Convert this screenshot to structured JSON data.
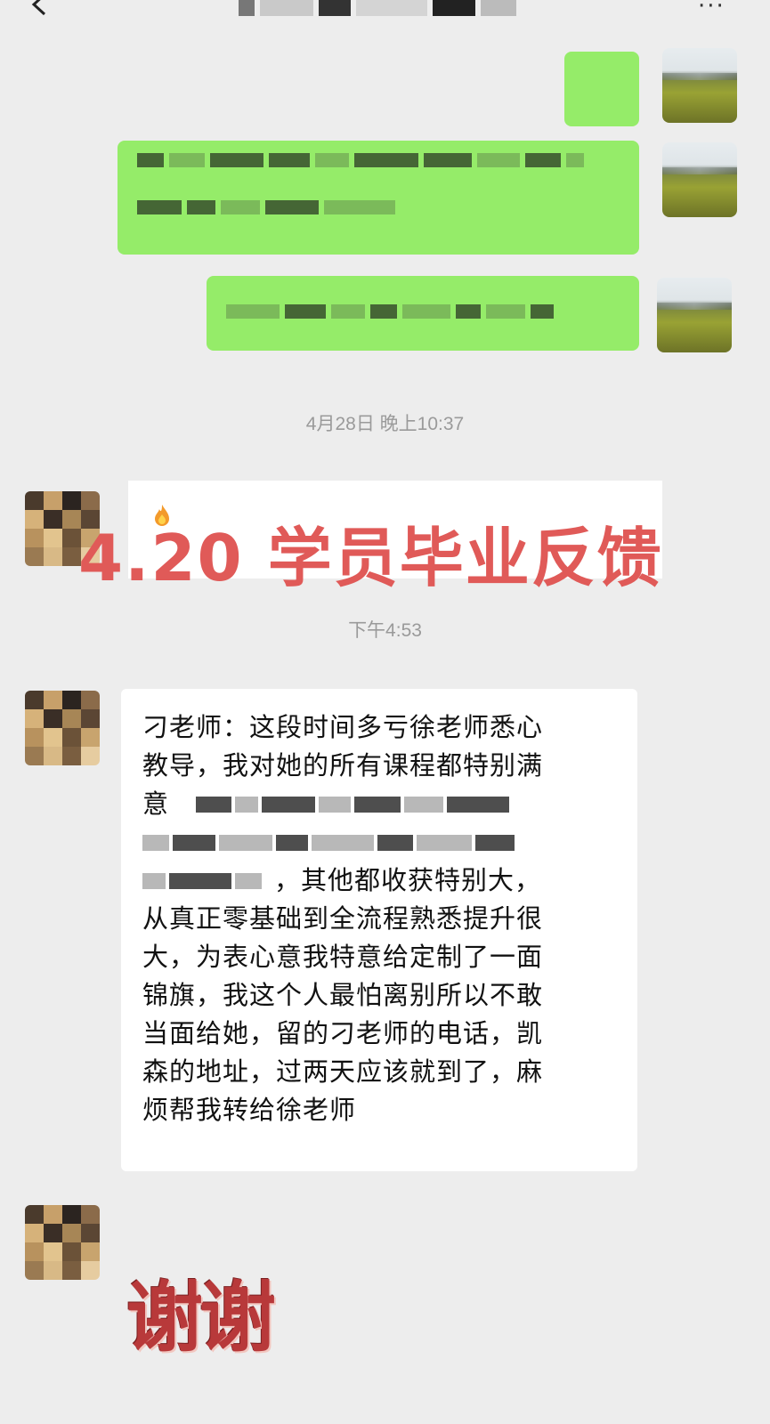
{
  "header": {
    "back_icon": "chevron-left-icon",
    "more_icon": "more-dots-icon",
    "more_label": "···"
  },
  "chat": {
    "timestamps": [
      "4月28日 晚上10:37",
      "下午4:53"
    ],
    "headline": "4.20 学员毕业反馈",
    "message": {
      "lines": [
        "刁老师：这段时间多亏徐老师悉心",
        "教导，我对她的所有课程都特别满",
        "意"
      ],
      "after_blur": "，其他都收获特别大，",
      "lines_after": [
        "从真正零基础到全流程熟悉提升很",
        "大，为表心意我特意给定制了一面",
        "锦旗，我这个人最怕离别所以不敢",
        "当面给她，留的刁老师的电话，凯",
        "森的地址，过两天应该就到了，麻",
        "烦帮我转给徐老师"
      ]
    },
    "sticker_text": "谢谢"
  },
  "colors": {
    "background": "#ededed",
    "sent_bubble": "#95ec69",
    "received_bubble": "#ffffff",
    "headline": "#e05a58",
    "timestamp": "#9a9a9a"
  }
}
